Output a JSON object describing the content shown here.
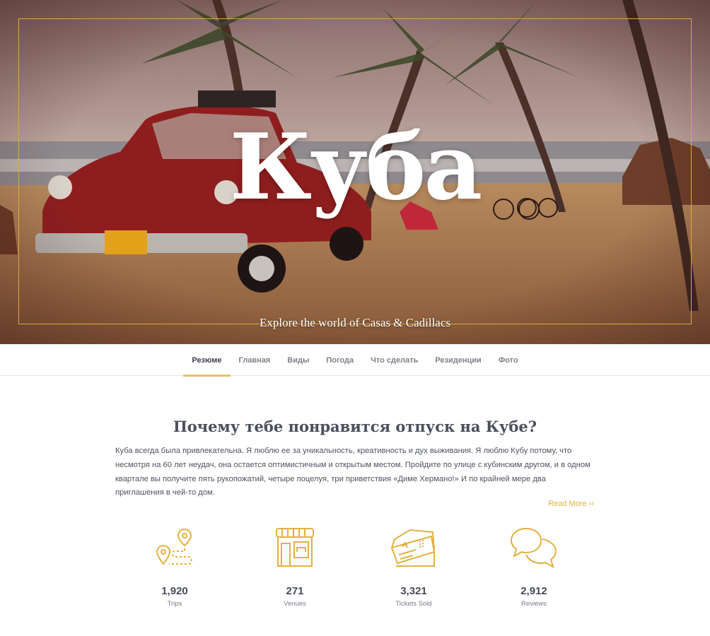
{
  "hero": {
    "title": "Куба",
    "tagline": "Explore the world of Casas & Cadillacs",
    "frame_color": "#d8ab38"
  },
  "nav": {
    "active_index": 0,
    "items": [
      {
        "label": "Резюме"
      },
      {
        "label": "Главная"
      },
      {
        "label": "Виды"
      },
      {
        "label": "Погода"
      },
      {
        "label": "Что сделать"
      },
      {
        "label": "Резиденции"
      },
      {
        "label": "Фото"
      }
    ]
  },
  "main": {
    "title": "Почему тебе понравится отпуск на Кубе?",
    "paragraph": "Куба всегда была привлекательна. Я люблю ее за уникальность, креативность и дух выживания. Я люблю Кубу потому, что несмотря на 60 лет неудач, она остается оптимистичным и открытым местом. Пройдите по улице с кубинским другом, и в одном квартале вы получите пять рукопожатий, четыре поцелуя, три приветствия «Диме Хермано!» И по крайней мере два приглашения в чей-то дом.",
    "read_more": "Read More ››"
  },
  "stats": [
    {
      "icon": "map-route-icon",
      "value": "1,920",
      "label": "Trips"
    },
    {
      "icon": "storefront-icon",
      "value": "271",
      "label": "Venues"
    },
    {
      "icon": "tickets-icon",
      "value": "3,321",
      "label": "Tickets Sold"
    },
    {
      "icon": "chat-bubbles-icon",
      "value": "2,912",
      "label": "Reviews"
    }
  ],
  "colors": {
    "accent": "#e2b042",
    "nav_underline": "#e9bf6a",
    "heading": "#4a4f5c"
  }
}
